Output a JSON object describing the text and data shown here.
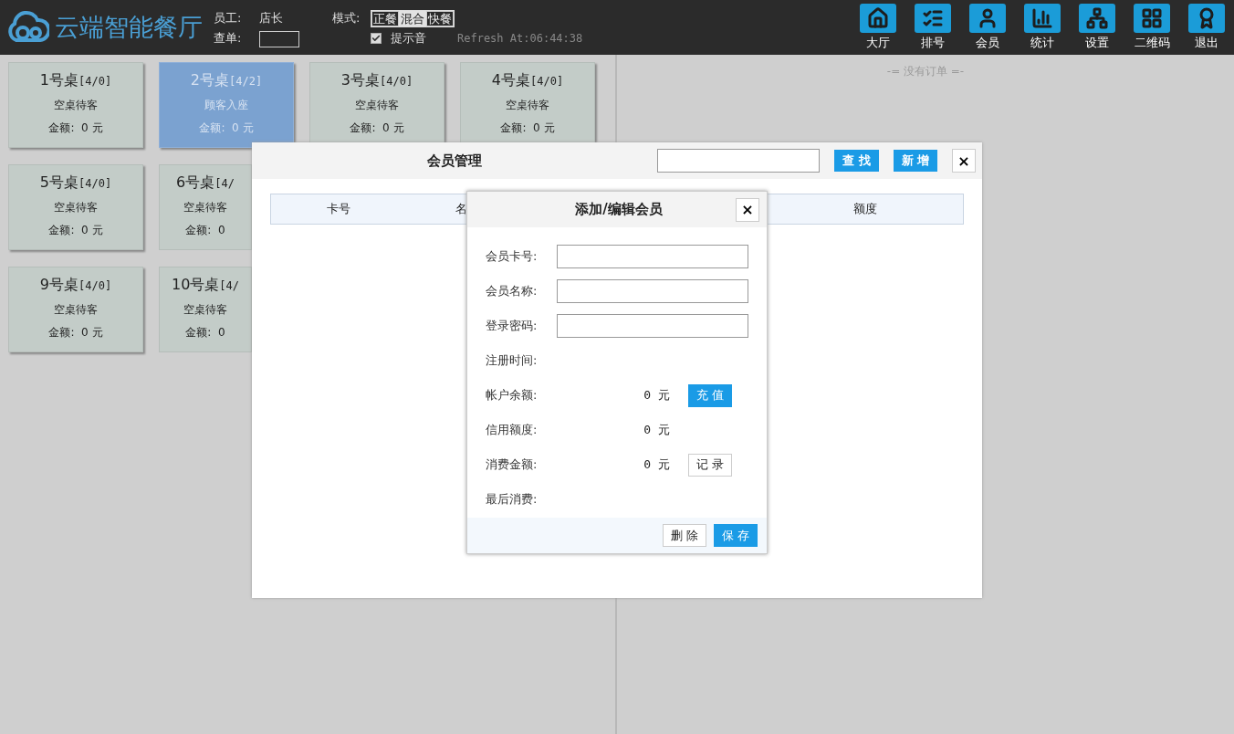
{
  "header": {
    "logo_text": "云端智能餐厅",
    "staff_label": "员工:",
    "staff_value": "店长",
    "mode_label": "模式:",
    "modes": [
      {
        "label": "正餐",
        "selected": false
      },
      {
        "label": "混合",
        "selected": true
      },
      {
        "label": "快餐",
        "selected": false
      }
    ],
    "order_label": "查单:",
    "sound": {
      "label": "提示音",
      "checked": true
    },
    "refresh": "Refresh At:06:44:38"
  },
  "nav": [
    {
      "label": "大厅"
    },
    {
      "label": "排号"
    },
    {
      "label": "会员"
    },
    {
      "label": "统计"
    },
    {
      "label": "设置"
    },
    {
      "label": "二维码"
    },
    {
      "label": "退出"
    }
  ],
  "table_rows": [
    [
      {
        "name": "1号桌",
        "seats": "[4/0]",
        "status": "空桌待客",
        "amount": "金额:  0 元",
        "selected": false,
        "clipped": false
      },
      {
        "name": "2号桌",
        "seats": "[4/2]",
        "status": "顾客入座",
        "amount": "金额:  0 元",
        "selected": true,
        "clipped": false
      },
      {
        "name": "3号桌",
        "seats": "[4/0]",
        "status": "空桌待客",
        "amount": "金额:  0 元",
        "selected": false,
        "clipped": false
      },
      {
        "name": "4号桌",
        "seats": "[4/0]",
        "status": "空桌待客",
        "amount": "金额:  0 元",
        "selected": false,
        "clipped": false
      }
    ],
    [
      {
        "name": "5号桌",
        "seats": "[4/0]",
        "status": "空桌待客",
        "amount": "金额:  0 元",
        "selected": false,
        "clipped": false
      },
      {
        "name": "6号桌",
        "seats": "[4/",
        "status": "空桌待客",
        "amount": "金额:  0",
        "selected": false,
        "clipped": true
      }
    ],
    [
      {
        "name": "9号桌",
        "seats": "[4/0]",
        "status": "空桌待客",
        "amount": "金额:  0 元",
        "selected": false,
        "clipped": false
      },
      {
        "name": "10号桌",
        "seats": "[4/",
        "status": "空桌待客",
        "amount": "金额:  0",
        "selected": false,
        "clipped": true
      }
    ]
  ],
  "orders_empty": "-= 没有订单 =-",
  "member_dialog": {
    "title": "会员管理",
    "search_button": "查 找",
    "add_button": "新 增",
    "close": "×",
    "columns": [
      "卡号",
      "名",
      "额度"
    ]
  },
  "edit_dialog": {
    "title": "添加/编辑会员",
    "close": "×",
    "fields": [
      {
        "kind": "input",
        "label": "会员卡号:"
      },
      {
        "kind": "input",
        "label": "会员名称:"
      },
      {
        "kind": "input",
        "label": "登录密码:"
      },
      {
        "kind": "text",
        "label": "注册时间:"
      },
      {
        "kind": "amount",
        "label": "帐户余额:",
        "value": "0 元",
        "button": {
          "label": "充 值",
          "primary": true
        }
      },
      {
        "kind": "amount",
        "label": "信用额度:",
        "value": "0 元"
      },
      {
        "kind": "amount",
        "label": "消费金额:",
        "value": "0 元",
        "button": {
          "label": "记 录",
          "primary": false
        }
      },
      {
        "kind": "text",
        "label": "最后消费:"
      }
    ],
    "buttons": [
      {
        "label": "删 除",
        "primary": false
      },
      {
        "label": "保 存",
        "primary": true
      }
    ]
  }
}
